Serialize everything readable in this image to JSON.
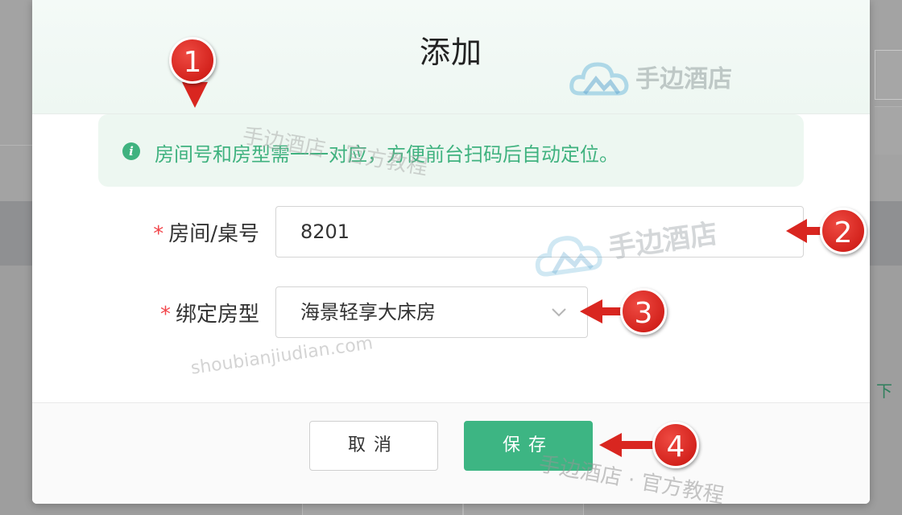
{
  "modal": {
    "title": "添加",
    "alert_text": "房间号和房型需一一对应，方便前台扫码后自动定位。",
    "fields": {
      "room_label": "房间/桌号",
      "room_value": "8201",
      "type_label": "绑定房型",
      "type_value": "海景轻享大床房",
      "required_mark": "*"
    },
    "buttons": {
      "cancel": "取消",
      "save": "保存"
    }
  },
  "markers": [
    "1",
    "2",
    "3",
    "4"
  ],
  "background": {
    "right_text": "下"
  },
  "watermark": {
    "brand": "手边酒店",
    "tagline": "手边酒店 · 官方教程",
    "url": "shoubianjiudian.com"
  },
  "colors": {
    "accent": "#3db583",
    "alert_bg": "#edf7f1",
    "required": "#f2464b",
    "marker": "#d4231d"
  }
}
